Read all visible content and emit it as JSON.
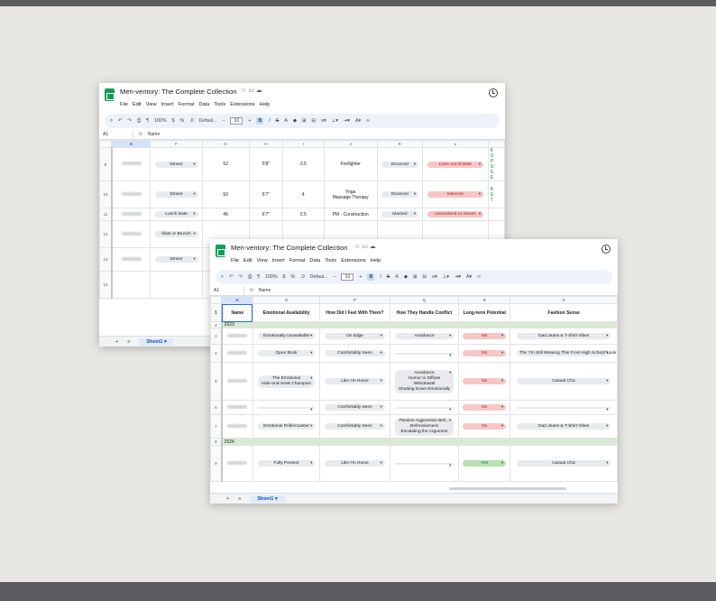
{
  "back": {
    "title": "Men-ventory: The Complete Collection",
    "menu": [
      "File",
      "Edit",
      "View",
      "Insert",
      "Format",
      "Data",
      "Tools",
      "Extensions",
      "Help"
    ],
    "toolbar": {
      "zoom": "100%",
      "font": "Defaul...",
      "size": "10",
      "bold": "B"
    },
    "cell_ref": "A1",
    "formula": "Name",
    "columns": [
      "A",
      "F",
      "G",
      "H",
      "I",
      "J",
      "K",
      "L"
    ],
    "rows": [
      {
        "n": "9",
        "f": "Dinner",
        "g": "52",
        "h": "5'8\"",
        "i": "3.5",
        "j": "Firefighter",
        "k": "Divorced",
        "l": "Lives out of state",
        "lc": "red",
        "m": "K\nS\nP\nS\nS\nE"
      },
      {
        "n": "10",
        "f": "Dinner",
        "g": "50",
        "h": "5'7\"",
        "i": "4",
        "j": "Yoga\nMassage Therapy",
        "k": "Divorced",
        "l": "Insecure",
        "lc": "red",
        "m": "K\nS\nT"
      },
      {
        "n": "11",
        "f": "Lunch  Date",
        "g": "45",
        "h": "6'7\"",
        "i": "2.5",
        "j": "PM - Construction",
        "k": "Married",
        "l": "Unresolved ex issues",
        "lc": "red",
        "m": ""
      },
      {
        "n": "12",
        "f": "kfast or Brunch",
        "g": "",
        "h": "",
        "i": "",
        "j": "",
        "k": "",
        "l": "",
        "lc": "",
        "m": ""
      },
      {
        "n": "13",
        "f": "Dinner",
        "g": "",
        "h": "",
        "i": "",
        "j": "",
        "k": "",
        "l": "",
        "lc": "",
        "m": ""
      },
      {
        "n": "14",
        "f": "",
        "g": "",
        "h": "",
        "i": "",
        "j": "",
        "k": "",
        "l": "",
        "lc": "",
        "m": ""
      }
    ],
    "sheet": "Sheet1"
  },
  "front": {
    "title": "Men-ventory: The Complete Collection",
    "menu": [
      "File",
      "Edit",
      "View",
      "Insert",
      "Format",
      "Data",
      "Tools",
      "Extensions",
      "Help"
    ],
    "toolbar": {
      "zoom": "100%",
      "font": "Defaul...",
      "size": "10",
      "bold": "B"
    },
    "cell_ref": "A1",
    "formula": "Name",
    "columns": [
      "A",
      "O",
      "P",
      "Q",
      "R",
      "S"
    ],
    "header": [
      "Name",
      "Emotional Availability",
      "How Did I Feel With Them?",
      "How They Handle Conflict",
      "Long-term Potential",
      "Fashion Sense"
    ],
    "rows": [
      {
        "n": "2",
        "year": "2023"
      },
      {
        "n": "3",
        "o": "Emotionally Unavailable",
        "p": "On Edge",
        "q": "Avoidance",
        "r": "No",
        "rc": "red",
        "s": "Dad Jeans & T-Shirt Vibes"
      },
      {
        "n": "4",
        "o": "Open Book",
        "p": "Comfortably Seen",
        "q": "",
        "r": "No",
        "rc": "red",
        "s": "The 'I'm Still Wearing This From High School' Look"
      },
      {
        "n": "5",
        "o": "The Emotional\nHide-and-Seek Champion",
        "p": "Like I'm Home",
        "q": "Avoidance\nHumor to Diffuse\nWithdrawal\nShutting Down Emotionally",
        "r": "No",
        "rc": "red",
        "s": "Casual Chic"
      },
      {
        "n": "6",
        "o": "",
        "p": "Comfortably Seen",
        "q": "",
        "r": "No",
        "rc": "red",
        "s": ""
      },
      {
        "n": "7",
        "o": "Emotional Rollercoaster",
        "p": "Comfortably Seen",
        "q": "Passive-Aggressive Beh...\nDefensiveness\nEscalating the Argument",
        "r": "No",
        "rc": "red",
        "s": "Dad Jeans & T-Shirt Vibes"
      },
      {
        "n": "8",
        "year": "2024"
      },
      {
        "n": "9",
        "o": "Fully Present",
        "p": "Like I'm Home",
        "q": "",
        "r": "Yes",
        "rc": "green",
        "s": "Casual Chic"
      }
    ],
    "sheet": "Sheet1"
  }
}
